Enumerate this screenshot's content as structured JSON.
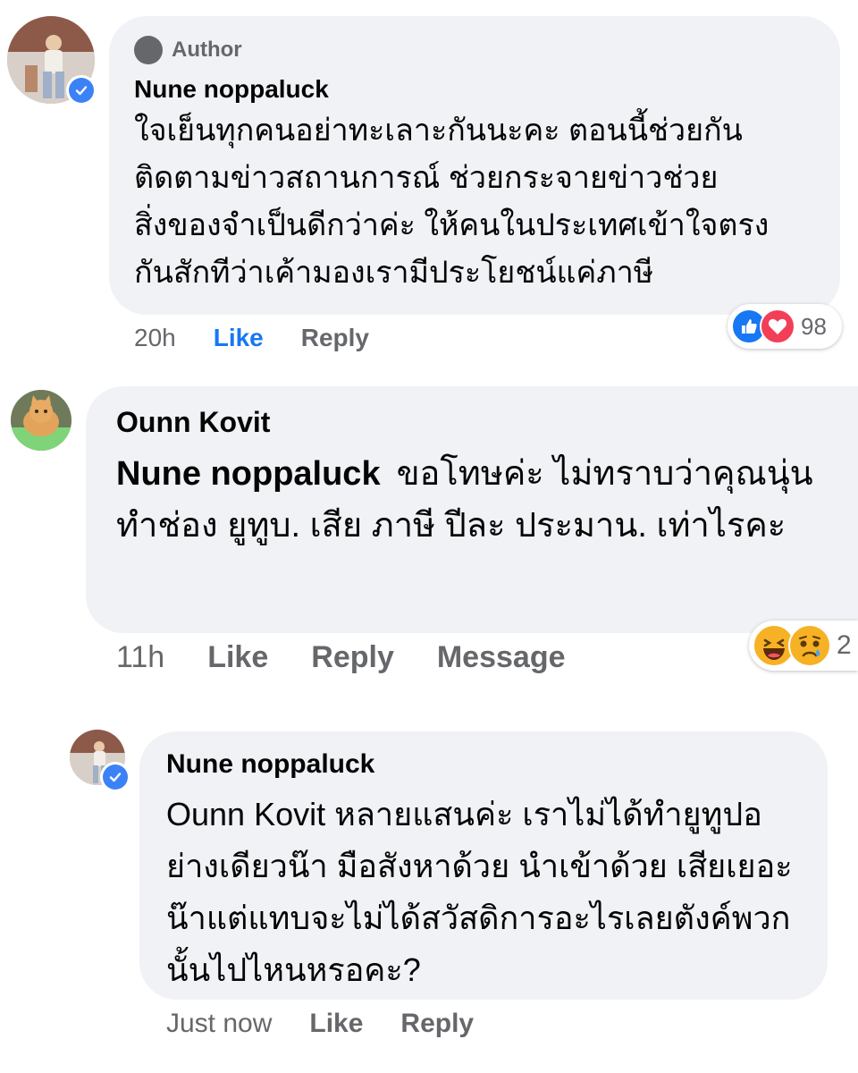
{
  "comments": [
    {
      "badge": "Author",
      "name": "Nune noppaluck",
      "text": "ใจเย็นทุกคนอย่าทะเลาะกันนะคะ ตอนนี้ช่วยกันติดตามข่าวสถานการณ์ ช่วยกระจายข่าวช่วยสิ่งของจำเป็นดีกว่าค่ะ ให้คนในประเทศเข้าใจตรงกันสักทีว่าเค้ามองเรามีประโยชน์แค่ภาษี",
      "time": "20h",
      "like": "Like",
      "reply": "Reply",
      "reaction_count": "98",
      "reactions": [
        "like-reaction",
        "love-reaction"
      ]
    },
    {
      "name": "Ounn Kovit",
      "mention": "Nune noppaluck",
      "text": "ขอโทษค่ะ ไม่ทราบว่าคุณนุ่น ทำช่อง ยูทูบ. เสีย ภาษี ปีละ ประมาน. เท่าไรคะ",
      "time": "11h",
      "like": "Like",
      "reply": "Reply",
      "message": "Message",
      "reaction_count": "2",
      "reactions": [
        "haha-reaction",
        "sad-reaction"
      ]
    },
    {
      "name": "Nune noppaluck",
      "text": "Ounn Kovit หลายแสนค่ะ เราไม่ได้ทำยูทูปอย่างเดียวน๊า มือสังหาด้วย นำเข้าด้วย เสียเยอะน๊าแต่แทบจะไม่ได้สวัสดิการอะไรเลยตังค์พวกนั้นไปไหนหรอคะ?",
      "time": "Just now",
      "like": "Like",
      "reply": "Reply"
    }
  ],
  "colors": {
    "bubble": "#f0f2f5",
    "secondary_text": "#65676b",
    "link_blue": "#1877f2",
    "verified_blue": "#3b82f6",
    "love_red": "#f33e58",
    "haha_yellow": "#f7b125"
  }
}
